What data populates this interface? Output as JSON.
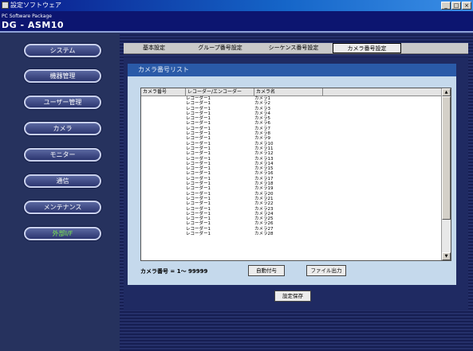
{
  "window": {
    "title": "設定ソフトウェア",
    "buttons": [
      "_",
      "□",
      "×"
    ]
  },
  "brand": {
    "subtitle": "PC Software Package",
    "product": "DG - ASM10"
  },
  "sidebar": {
    "items": [
      {
        "label": "システム",
        "active": false
      },
      {
        "label": "機器管理",
        "active": false
      },
      {
        "label": "ユーザー管理",
        "active": false
      },
      {
        "label": "カメラ",
        "active": false
      },
      {
        "label": "モニター",
        "active": false
      },
      {
        "label": "通信",
        "active": false
      },
      {
        "label": "メンテナンス",
        "active": false
      },
      {
        "label": "外部I/F",
        "active": true
      }
    ]
  },
  "tabs": [
    {
      "label": "基本設定",
      "active": false
    },
    {
      "label": "グループ番号設定",
      "active": false
    },
    {
      "label": "シーケンス番号設定",
      "active": false
    },
    {
      "label": "カメラ番号設定",
      "active": true
    }
  ],
  "panel": {
    "title": "カメラ番号リスト",
    "columns": [
      "カメラ番号",
      "レコーダー/エンコーダー",
      "カメラ名"
    ],
    "rows": [
      [
        "",
        "レコーダー1",
        "カメラ1"
      ],
      [
        "",
        "レコーダー1",
        "カメラ2"
      ],
      [
        "",
        "レコーダー1",
        "カメラ3"
      ],
      [
        "",
        "レコーダー1",
        "カメラ4"
      ],
      [
        "",
        "レコーダー1",
        "カメラ5"
      ],
      [
        "",
        "レコーダー1",
        "カメラ6"
      ],
      [
        "",
        "レコーダー1",
        "カメラ7"
      ],
      [
        "",
        "レコーダー1",
        "カメラ8"
      ],
      [
        "",
        "レコーダー1",
        "カメラ9"
      ],
      [
        "",
        "レコーダー1",
        "カメラ10"
      ],
      [
        "",
        "レコーダー1",
        "カメラ11"
      ],
      [
        "",
        "レコーダー1",
        "カメラ12"
      ],
      [
        "",
        "レコーダー1",
        "カメラ13"
      ],
      [
        "",
        "レコーダー1",
        "カメラ14"
      ],
      [
        "",
        "レコーダー1",
        "カメラ15"
      ],
      [
        "",
        "レコーダー1",
        "カメラ16"
      ],
      [
        "",
        "レコーダー1",
        "カメラ17"
      ],
      [
        "",
        "レコーダー1",
        "カメラ18"
      ],
      [
        "",
        "レコーダー1",
        "カメラ19"
      ],
      [
        "",
        "レコーダー1",
        "カメラ20"
      ],
      [
        "",
        "レコーダー1",
        "カメラ21"
      ],
      [
        "",
        "レコーダー1",
        "カメラ22"
      ],
      [
        "",
        "レコーダー1",
        "カメラ23"
      ],
      [
        "",
        "レコーダー1",
        "カメラ24"
      ],
      [
        "",
        "レコーダー1",
        "カメラ25"
      ],
      [
        "",
        "レコーダー1",
        "カメラ26"
      ],
      [
        "",
        "レコーダー1",
        "カメラ27"
      ],
      [
        "",
        "レコーダー1",
        "カメラ28"
      ]
    ],
    "range_text": "カメラ番号 = 1～ 99999",
    "auto_assign_label": "自動付与",
    "file_output_label": "ファイル出力"
  },
  "footer": {
    "save_label": "設定保存"
  }
}
